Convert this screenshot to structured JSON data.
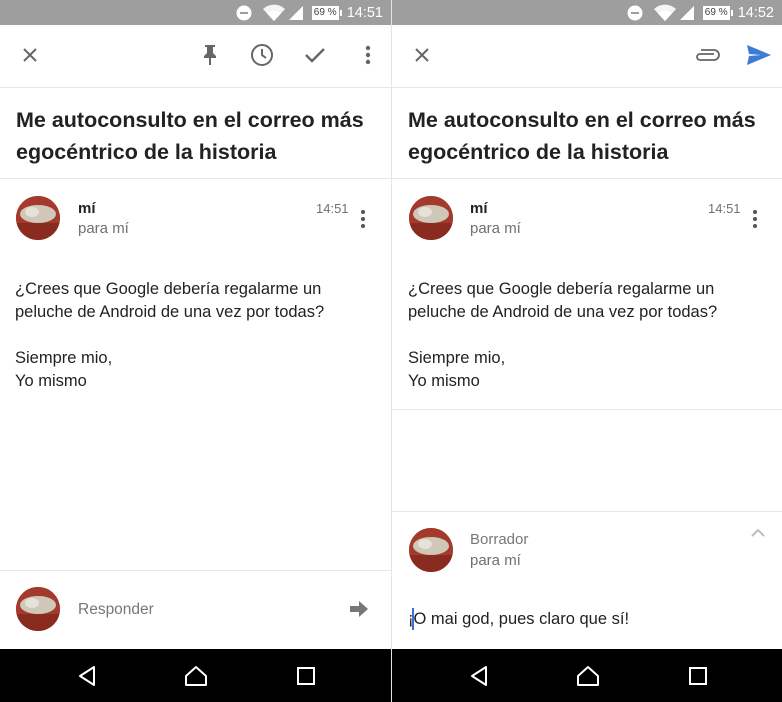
{
  "colors": {
    "statusbar": "#9e9e9e",
    "accent": "#3b7cd4",
    "navbar": "#000000",
    "avatar": "#a33a2c"
  },
  "left": {
    "status": {
      "time": "14:51",
      "battery": "69 %"
    },
    "toolbar": {
      "icons": [
        "close-icon",
        "pin-icon",
        "snooze-clock-icon",
        "done-check-icon",
        "more-vert-icon"
      ]
    },
    "email": {
      "subject": "Me autoconsulto en el correo más egocéntrico de la historia",
      "sender": "mí",
      "recipient": "para mí",
      "time": "14:51",
      "body": "¿Crees que Google debería regalarme un\npeluche de Android de una vez por todas?\n\nSiempre mio,\nYo mismo"
    },
    "reply": {
      "placeholder": "Responder",
      "icon": "forward-arrow-icon"
    },
    "navbar": {
      "icons": [
        "back-icon",
        "home-icon",
        "recents-icon"
      ]
    }
  },
  "right": {
    "status": {
      "time": "14:52",
      "battery": "69 %"
    },
    "toolbar": {
      "icons": [
        "close-icon",
        "attach-icon",
        "send-icon"
      ]
    },
    "email": {
      "subject": "Me autoconsulto en el correo más egocéntrico de la historia",
      "sender": "mí",
      "recipient": "para mí",
      "time": "14:51",
      "body": "¿Crees que Google debería regalarme un\npeluche de Android de una vez por todas?\n\nSiempre mio,\nYo mismo"
    },
    "draft": {
      "label": "Borrador",
      "recipient": "para mí",
      "text": "¡O mai god, pues claro que sí!",
      "icon": "chevron-up-icon"
    },
    "navbar": {
      "icons": [
        "back-icon",
        "home-icon",
        "recents-icon"
      ]
    }
  }
}
